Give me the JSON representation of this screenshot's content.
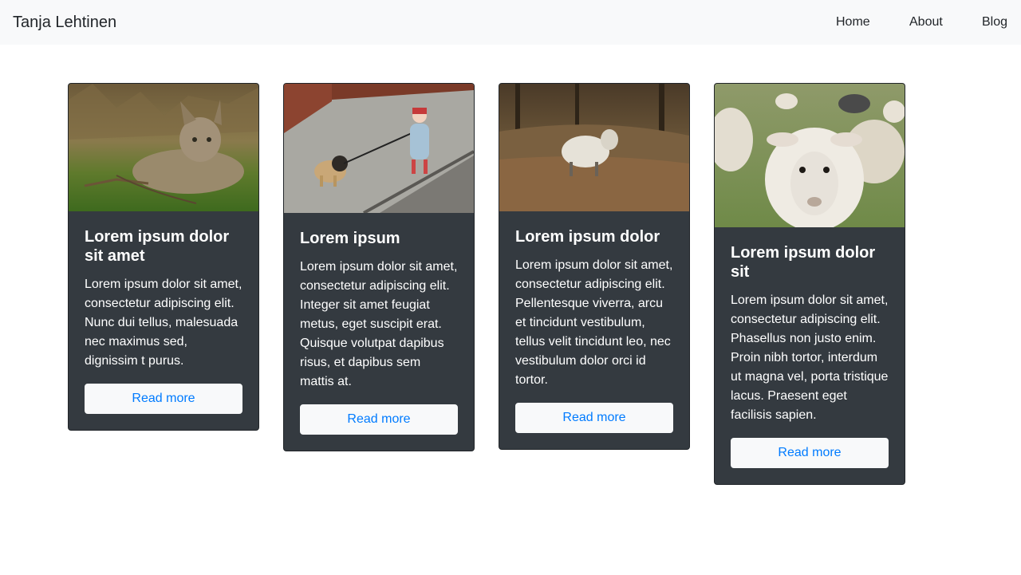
{
  "navbar": {
    "brand": "Tanja Lehtinen",
    "links": [
      "Home",
      "About",
      "Blog"
    ]
  },
  "cards": [
    {
      "image": "cat-photo",
      "title": "Lorem ipsum dolor sit amet",
      "text": "Lorem ipsum dolor sit amet, consectetur adipiscing elit. Nunc dui tellus, malesuada nec maximus sed, dignissim t purus.",
      "button": "Read more"
    },
    {
      "image": "child-walking-pug-photo",
      "title": "Lorem ipsum",
      "text": "Lorem ipsum dolor sit amet, consectetur adipiscing elit. Integer sit amet feugiat metus, eget suscipit erat. Quisque volutpat dapibus risus, et dapibus sem mattis at.",
      "button": "Read more"
    },
    {
      "image": "sheep-in-field-photo",
      "title": "Lorem ipsum dolor",
      "text": "Lorem ipsum dolor sit amet, consectetur adipiscing elit. Pellentesque viverra, arcu et tincidunt vestibulum, tellus velit tincidunt leo, nec vestibulum dolor orci id tortor.",
      "button": "Read more"
    },
    {
      "image": "sheep-closeup-photo",
      "title": "Lorem ipsum dolor sit",
      "text": "Lorem ipsum dolor sit amet, consectetur adipiscing elit. Phasellus non justo enim. Proin nibh tortor, interdum ut magna vel, porta tristique lacus. Praesent eget facilisis sapien.",
      "button": "Read more"
    }
  ],
  "colors": {
    "navbar_bg": "#f8f9fa",
    "card_bg": "#343a40",
    "button_bg": "#f8f9fa",
    "button_text": "#007bff"
  }
}
